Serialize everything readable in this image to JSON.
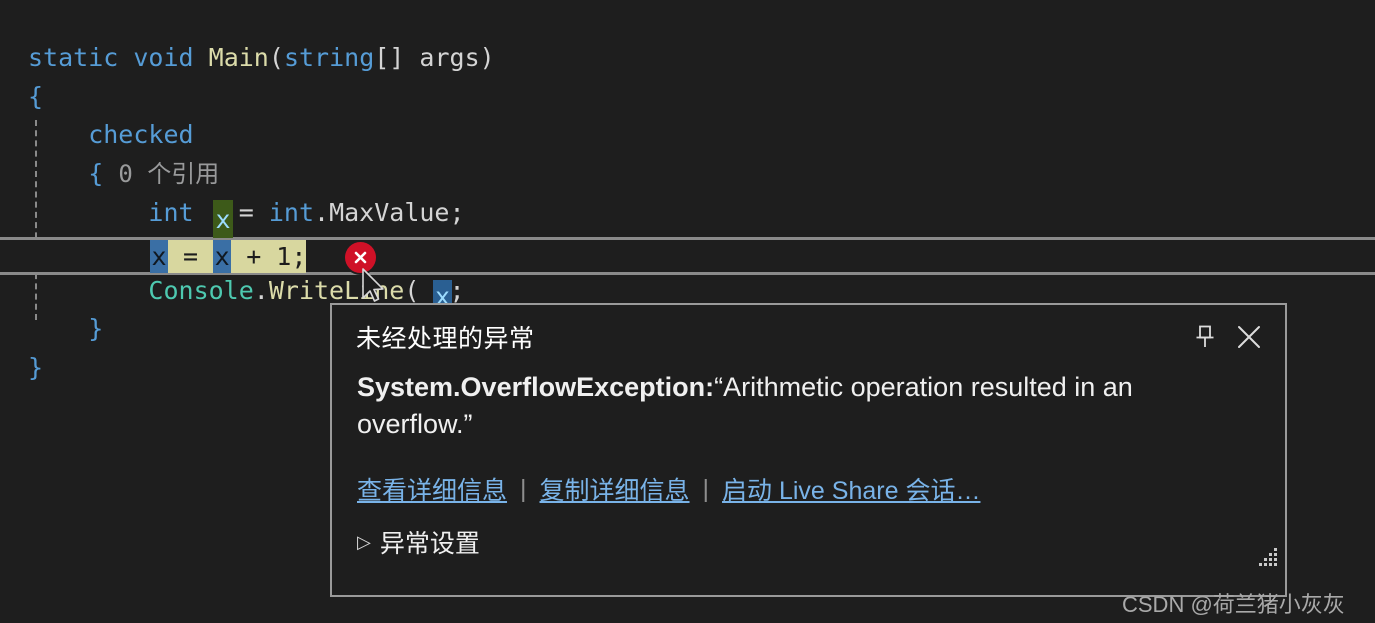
{
  "editor": {
    "codelens": "0 个引用",
    "lines": [
      {
        "id": "l1",
        "tokens": [
          {
            "t": "static",
            "c": "kw"
          },
          {
            "t": " ",
            "c": "plain"
          },
          {
            "t": "void",
            "c": "kw"
          },
          {
            "t": " ",
            "c": "plain"
          },
          {
            "t": "Main",
            "c": "meth"
          },
          {
            "t": "(",
            "c": "punct"
          },
          {
            "t": "string",
            "c": "kw"
          },
          {
            "t": "[]",
            "c": "punct"
          },
          {
            "t": " ",
            "c": "plain"
          },
          {
            "t": "args",
            "c": "plain"
          },
          {
            "t": ")",
            "c": "punct"
          }
        ]
      },
      {
        "id": "l2",
        "tokens": [
          {
            "t": "{",
            "c": "brace"
          }
        ]
      },
      {
        "id": "l3",
        "tokens": [
          {
            "t": "    checked",
            "c": "kw"
          }
        ]
      },
      {
        "id": "l4",
        "tokens": [
          {
            "t": "    ",
            "c": "plain"
          },
          {
            "t": "{",
            "c": "brace"
          }
        ]
      },
      {
        "id": "l5",
        "tokens": [
          {
            "t": "        ",
            "c": "plain"
          },
          {
            "t": "int",
            "c": "kw"
          },
          {
            "t": " ",
            "c": "plain"
          },
          {
            "t": " ",
            "c": "plain"
          },
          {
            "t": " = ",
            "c": "punct"
          },
          {
            "t": "int",
            "c": "kw"
          },
          {
            "t": ".",
            "c": "punct"
          },
          {
            "t": "MaxValue",
            "c": "plain"
          },
          {
            "t": ";",
            "c": "punct"
          }
        ]
      },
      {
        "id": "l6",
        "tokens": [
          {
            "t": "",
            "c": "plain"
          }
        ]
      },
      {
        "id": "l7",
        "tokens": [
          {
            "t": "        ",
            "c": "plain"
          },
          {
            "t": "Console",
            "c": "cls"
          },
          {
            "t": ".",
            "c": "punct"
          },
          {
            "t": "WriteLine",
            "c": "meth"
          },
          {
            "t": "(",
            "c": "punct"
          },
          {
            "t": " ",
            "c": "plain"
          },
          {
            "t": ")",
            "c": "punct"
          },
          {
            "t": ";",
            "c": "punct"
          }
        ]
      },
      {
        "id": "l8",
        "tokens": [
          {
            "t": "    ",
            "c": "plain"
          },
          {
            "t": "}",
            "c": "brace"
          }
        ]
      },
      {
        "id": "l9",
        "tokens": [
          {
            "t": "}",
            "c": "brace"
          }
        ]
      }
    ],
    "current_statement": {
      "segments": [
        {
          "text": "x",
          "style": "ref"
        },
        {
          "text": " = ",
          "style": "plain"
        },
        {
          "text": "x",
          "style": "ref"
        },
        {
          "text": " + 1;",
          "style": "plain"
        }
      ],
      "raw": "x = x + 1;"
    },
    "write_ref_var": "x",
    "read_ref_var": "x",
    "error_glyph": "error-circle-icon"
  },
  "dialog": {
    "title": "未经处理的异常",
    "pin_tooltip": "pin-icon",
    "close_tooltip": "close-icon",
    "exception_type": "System.OverflowException:",
    "exception_message": "“Arithmetic operation resulted in an overflow.”",
    "links": [
      "查看详细信息",
      "复制详细信息",
      "启动 Live Share 会话…"
    ],
    "separator": "|",
    "settings_label": "异常设置",
    "expander_arrow": "▷"
  },
  "watermark": "CSDN @荷兰猪小灰灰",
  "colors": {
    "background": "#1e1e1e",
    "keyword": "#569cd6",
    "class": "#4ec9b0",
    "method": "#dcdcaa",
    "text": "#d4d4d4",
    "codelens": "#999a9b",
    "statement_highlight": "#d8d79f",
    "read_reference": "#2a5f92",
    "write_reference": "#3d5a19",
    "error_red": "#cf1127",
    "link_blue": "#79b3e8",
    "dialog_border": "#9a9a9a"
  }
}
